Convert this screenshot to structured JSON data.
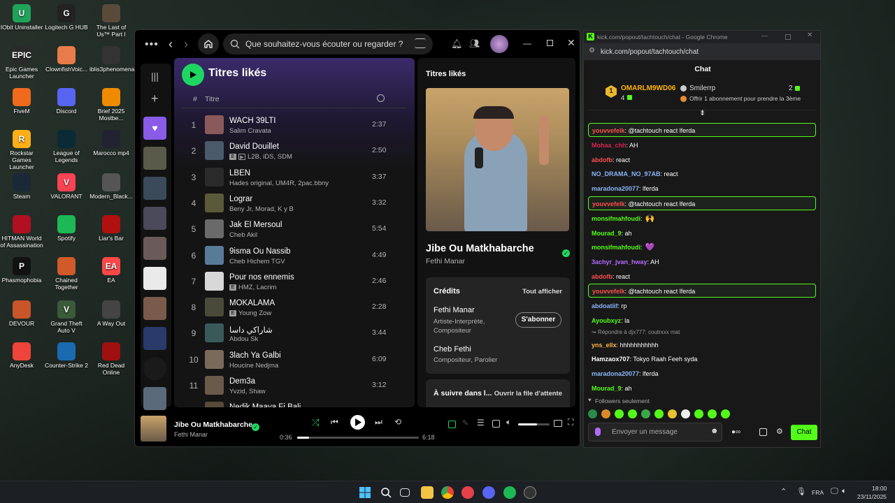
{
  "desktop": {
    "icons": [
      {
        "label": "IObit Uninstaller",
        "glyph": "U",
        "color": "#1fa35a"
      },
      {
        "label": "Logitech G HUB",
        "glyph": "G",
        "color": "#222"
      },
      {
        "label": "The Last of Us™ Part I",
        "glyph": "",
        "color": "#5a4a3a"
      },
      {
        "label": "Epic Games Launcher",
        "glyph": "EPIC",
        "color": "#2a2a2a"
      },
      {
        "label": "ClownfishVoic...",
        "glyph": "",
        "color": "#e87b4a"
      },
      {
        "label": "iblis3phenomena",
        "glyph": "",
        "color": "#333"
      },
      {
        "label": "FiveM",
        "glyph": "",
        "color": "#f06a1e"
      },
      {
        "label": "Discord",
        "glyph": "",
        "color": "#5865f2"
      },
      {
        "label": "Brief 2025 Mostbe...",
        "glyph": "",
        "color": "#f08a00"
      },
      {
        "label": "Rockstar Games Launcher",
        "glyph": "R",
        "color": "#fcaf17"
      },
      {
        "label": "League of Legends",
        "glyph": "",
        "color": "#0a2a35"
      },
      {
        "label": "Marocco mp4",
        "glyph": "",
        "color": "#223"
      },
      {
        "label": "Steam",
        "glyph": "",
        "color": "#1b2838"
      },
      {
        "label": "VALORANT",
        "glyph": "V",
        "color": "#fa4454"
      },
      {
        "label": "Modern_Black...",
        "glyph": "",
        "color": "#555"
      },
      {
        "label": "HITMAN World of Assassination",
        "glyph": "",
        "color": "#b01020"
      },
      {
        "label": "Spotify",
        "glyph": "",
        "color": "#1db954"
      },
      {
        "label": "Liar's Bar",
        "glyph": "",
        "color": "#b01010"
      },
      {
        "label": "Phasmophobia",
        "glyph": "P",
        "color": "#111"
      },
      {
        "label": "Chained Together",
        "glyph": "",
        "color": "#d05a2a"
      },
      {
        "label": "EA",
        "glyph": "EA",
        "color": "#ff4747"
      },
      {
        "label": "DEVOUR",
        "glyph": "",
        "color": "#c8552a"
      },
      {
        "label": "Grand Theft Auto V",
        "glyph": "V",
        "color": "#3a5a3a"
      },
      {
        "label": "A Way Out",
        "glyph": "",
        "color": "#444"
      },
      {
        "label": "AnyDesk",
        "glyph": "",
        "color": "#ef443b"
      },
      {
        "label": "Counter-Strike 2",
        "glyph": "",
        "color": "#1a6ab0"
      },
      {
        "label": "Red Dead Online",
        "glyph": "",
        "color": "#a01010"
      }
    ]
  },
  "spotify": {
    "search_placeholder": "Que souhaitez-vous écouter ou regarder ?",
    "playlist_title": "Titres likés",
    "col_hash": "#",
    "col_title": "Titre",
    "tracks": [
      {
        "n": "1",
        "title": "WACH 39LTI",
        "artist": "Salim Cravata",
        "dur": "2:37",
        "explicit": false,
        "video": false,
        "color": "#8a5a5a"
      },
      {
        "n": "2",
        "title": "David Douillet",
        "artist": "L2B, iDS, SDM",
        "dur": "2:50",
        "explicit": true,
        "video": true,
        "color": "#4a5a6a"
      },
      {
        "n": "3",
        "title": "LBEN",
        "artist": "Hades original, UM4R, 2pac.bbny",
        "dur": "3:37",
        "explicit": false,
        "video": false,
        "color": "#2a2a2a"
      },
      {
        "n": "4",
        "title": "Lograr",
        "artist": "Beny Jr, Morad, K y B",
        "dur": "3:32",
        "explicit": false,
        "video": false,
        "color": "#5a5a3a"
      },
      {
        "n": "5",
        "title": "Jak El Mersoul",
        "artist": "Cheb Akil",
        "dur": "5:54",
        "explicit": false,
        "video": false,
        "color": "#6a6a6a"
      },
      {
        "n": "6",
        "title": "9isma Ou Nassib",
        "artist": "Cheb Hichem TGV",
        "dur": "4:49",
        "explicit": false,
        "video": false,
        "color": "#5a7a9a"
      },
      {
        "n": "7",
        "title": "Pour nos ennemis",
        "artist": "HMZ, Lacrim",
        "dur": "2:46",
        "explicit": true,
        "video": false,
        "color": "#d8d8d8"
      },
      {
        "n": "8",
        "title": "MOKALAMA",
        "artist": "Young Zow",
        "dur": "2:28",
        "explicit": true,
        "video": false,
        "color": "#4a4a3a"
      },
      {
        "n": "9",
        "title": "شاراكي داسا",
        "artist": "Abdou Sk",
        "dur": "3:44",
        "explicit": false,
        "video": false,
        "color": "#3a5a5a"
      },
      {
        "n": "10",
        "title": "3lach Ya Galbi",
        "artist": "Houcine Nedjma",
        "dur": "6:09",
        "explicit": false,
        "video": false,
        "color": "#7a6a5a"
      },
      {
        "n": "11",
        "title": "Dem3a",
        "artist": "Yvzid, Shaw",
        "dur": "3:12",
        "explicit": false,
        "video": false,
        "color": "#6a5a4a"
      },
      {
        "n": "",
        "title": "Nedik Maaya Fi Bali",
        "artist": "",
        "dur": "",
        "explicit": false,
        "video": false,
        "color": "#5a4a3a"
      }
    ],
    "right_header": "Titres likés",
    "now_title": "Jibe Ou Matkhabarche",
    "now_artist": "Fethi Manar",
    "credits_label": "Crédits",
    "show_all": "Tout afficher",
    "credit1_name": "Fethi Manar",
    "credit1_role": "Artiste-Interprète, Compositeur",
    "subscribe": "S'abonner",
    "credit2_name": "Cheb Fethi",
    "credit2_role": "Compositeur, Parolier",
    "queue_label": "À suivre dans l...",
    "open_queue": "Ouvrir la file d'attente",
    "player_title": "Jibe Ou Matkhabarche",
    "player_artist": "Fethi Manar",
    "time_current": "0:36",
    "time_total": "6:18",
    "progress": 0.1,
    "volume": 0.6
  },
  "kick": {
    "window_title": "kick.com/popout/tachtouch/chat - Google Chrome",
    "url": "kick.com/popout/tachtouch/chat",
    "chat_header": "Chat",
    "top_user": "OMARLM9WD06",
    "top_user_count": "4",
    "top_user2": "Smilerrp",
    "top_user2_count": "2",
    "gift_text": "Offrir 1 abonnement pour prendre la 3ème",
    "messages": [
      {
        "user": "youvvefelk",
        "text": ": @tachtouch react lferda",
        "color": "#ff4d4d",
        "hl": true
      },
      {
        "user": "Mohaa_chh",
        "text": ": AH",
        "color": "#d4244d",
        "hl": false
      },
      {
        "user": "abdofb",
        "text": ": react",
        "color": "#ff4d4d",
        "hl": false
      },
      {
        "user": "NO_DRAMA_NO_97AB",
        "text": ": react",
        "color": "#8ab4f8",
        "hl": false
      },
      {
        "user": "maradona20077",
        "text": ": lferda",
        "color": "#8ab4f8",
        "hl": false
      },
      {
        "user": "youvvefelk",
        "text": ": @tachtouch react lferda",
        "color": "#ff4d4d",
        "hl": true
      },
      {
        "user": "monsifmahfoudi",
        "text": ":",
        "color": "#53fc18",
        "hl": false,
        "emote": "🙌"
      },
      {
        "user": "Mourad_9",
        "text": ": ah",
        "color": "#53fc18",
        "hl": false
      },
      {
        "user": "monsifmahfoudi",
        "text": ":",
        "color": "#53fc18",
        "hl": false,
        "emote": "💜"
      },
      {
        "user": "3achyr_jvan_hway",
        "text": ": AH",
        "color": "#b36bff",
        "hl": false
      },
      {
        "user": "abdofb",
        "text": ": react",
        "color": "#ff4d4d",
        "hl": false
      },
      {
        "user": "youvvefelk",
        "text": ": @tachtouch react lferda",
        "color": "#ff4d4d",
        "hl": true
      },
      {
        "user": "abdoatiif",
        "text": ": rp",
        "color": "#8ab4f8",
        "hl": false
      },
      {
        "user": "Ayoubxyz",
        "text": ": la",
        "color": "#53fc18",
        "hl": false
      },
      {
        "user": "yns_ellx",
        "text": ": hhhhhhhhhhh",
        "color": "#ffb347",
        "hl": false,
        "reply": "Répondre à djx777: coutrxxx mat"
      },
      {
        "user": "Hamzaox707",
        "text": ": Tokyo Raah Feeh syda",
        "color": "#fff",
        "hl": false
      },
      {
        "user": "maradona20077",
        "text": ": lferda",
        "color": "#8ab4f8",
        "hl": false
      },
      {
        "user": "Mourad_9",
        "text": ": ah",
        "color": "#53fc18",
        "hl": false
      }
    ],
    "followers_only": "Followers seulement",
    "input_placeholder": "Envoyer un message",
    "chat_button": "Chat"
  },
  "taskbar": {
    "lang": "FRA",
    "time": "18:00",
    "date": "23/11/2025"
  }
}
